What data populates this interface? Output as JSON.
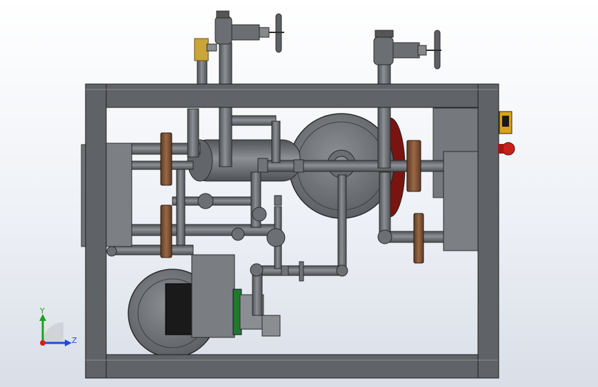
{
  "view": {
    "background_top": "#ffffff",
    "background_bottom": "#d9dee7"
  },
  "triad": {
    "y_label": "Y",
    "z_label": "Z",
    "y_color": "#1aa31a",
    "z_color": "#2049d6",
    "origin_color": "#d61b1b"
  },
  "model": {
    "steel_color": "#6f7276",
    "steel_dark": "#4a4d51",
    "flange_color": "#8a5a3c",
    "accent_green": "#1f7a2a",
    "accent_red": "#c8201c",
    "accent_yellow": "#d7a11a",
    "brass_color": "#b8942a"
  }
}
